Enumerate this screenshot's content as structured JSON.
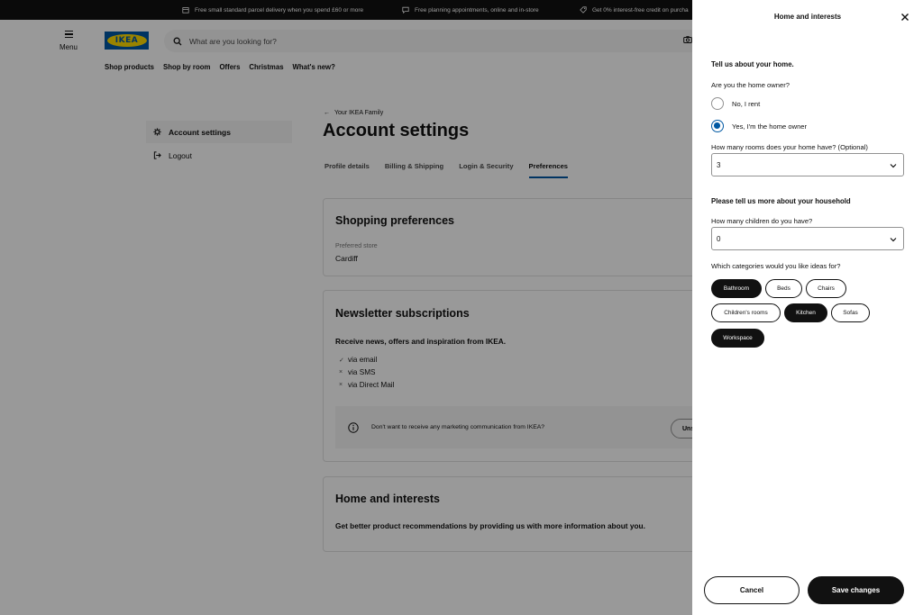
{
  "promo": [
    {
      "icon": "box-icon",
      "text": "Free small standard parcel delivery when you spend £60 or more"
    },
    {
      "icon": "chat-icon",
      "text": "Free planning appointments, online and in-store"
    },
    {
      "icon": "tag-icon",
      "text": "Get 0% interest-free credit on purcha"
    }
  ],
  "header": {
    "menu_label": "Menu",
    "logo_text": "IKEA",
    "search_placeholder": "What are you looking for?",
    "nav": [
      "Shop products",
      "Shop by room",
      "Offers",
      "Christmas",
      "What's new?"
    ]
  },
  "sidebar": {
    "items": [
      {
        "label": "Account settings",
        "icon": "gear-icon"
      },
      {
        "label": "Logout",
        "icon": "logout-icon"
      }
    ]
  },
  "main": {
    "back_link": "Your IKEA Family",
    "title": "Account settings",
    "tabs": [
      "Profile details",
      "Billing & Shipping",
      "Login & Security",
      "Preferences"
    ],
    "active_tab": "Preferences",
    "shopping": {
      "title": "Shopping preferences",
      "store_label": "Preferred store",
      "store_value": "Cardiff"
    },
    "newsletter": {
      "title": "Newsletter subscriptions",
      "subtitle": "Receive news, offers and inspiration from IKEA.",
      "channels": [
        {
          "mark": "✓",
          "label": "via email"
        },
        {
          "mark": "×",
          "label": "via SMS"
        },
        {
          "mark": "×",
          "label": "via Direct Mail"
        }
      ],
      "info_text": "Don't want to receive any marketing communication from IKEA?",
      "unsubscribe_label": "Uns"
    },
    "home": {
      "title": "Home and interests",
      "subtitle": "Get better product recommendations by providing us with more information about you."
    }
  },
  "panel": {
    "title": "Home and interests",
    "section1_heading": "Tell us about your home.",
    "owner_question": "Are you the home owner?",
    "owner_options": [
      "No, I rent",
      "Yes, I'm the home owner"
    ],
    "owner_selected": 1,
    "rooms_label": "How many rooms does your home have? (Optional)",
    "rooms_value": "3",
    "section2_heading": "Please tell us more about your household",
    "children_label": "How many children do you have?",
    "children_value": "0",
    "categories_label": "Which categories would you like ideas for?",
    "categories": [
      {
        "label": "Bathroom",
        "selected": true
      },
      {
        "label": "Beds",
        "selected": false
      },
      {
        "label": "Chairs",
        "selected": false
      },
      {
        "label": "Children's rooms",
        "selected": false
      },
      {
        "label": "Kitchen",
        "selected": true
      },
      {
        "label": "Sofas",
        "selected": false
      },
      {
        "label": "Workspace",
        "selected": true
      }
    ],
    "cancel_label": "Cancel",
    "save_label": "Save changes"
  }
}
